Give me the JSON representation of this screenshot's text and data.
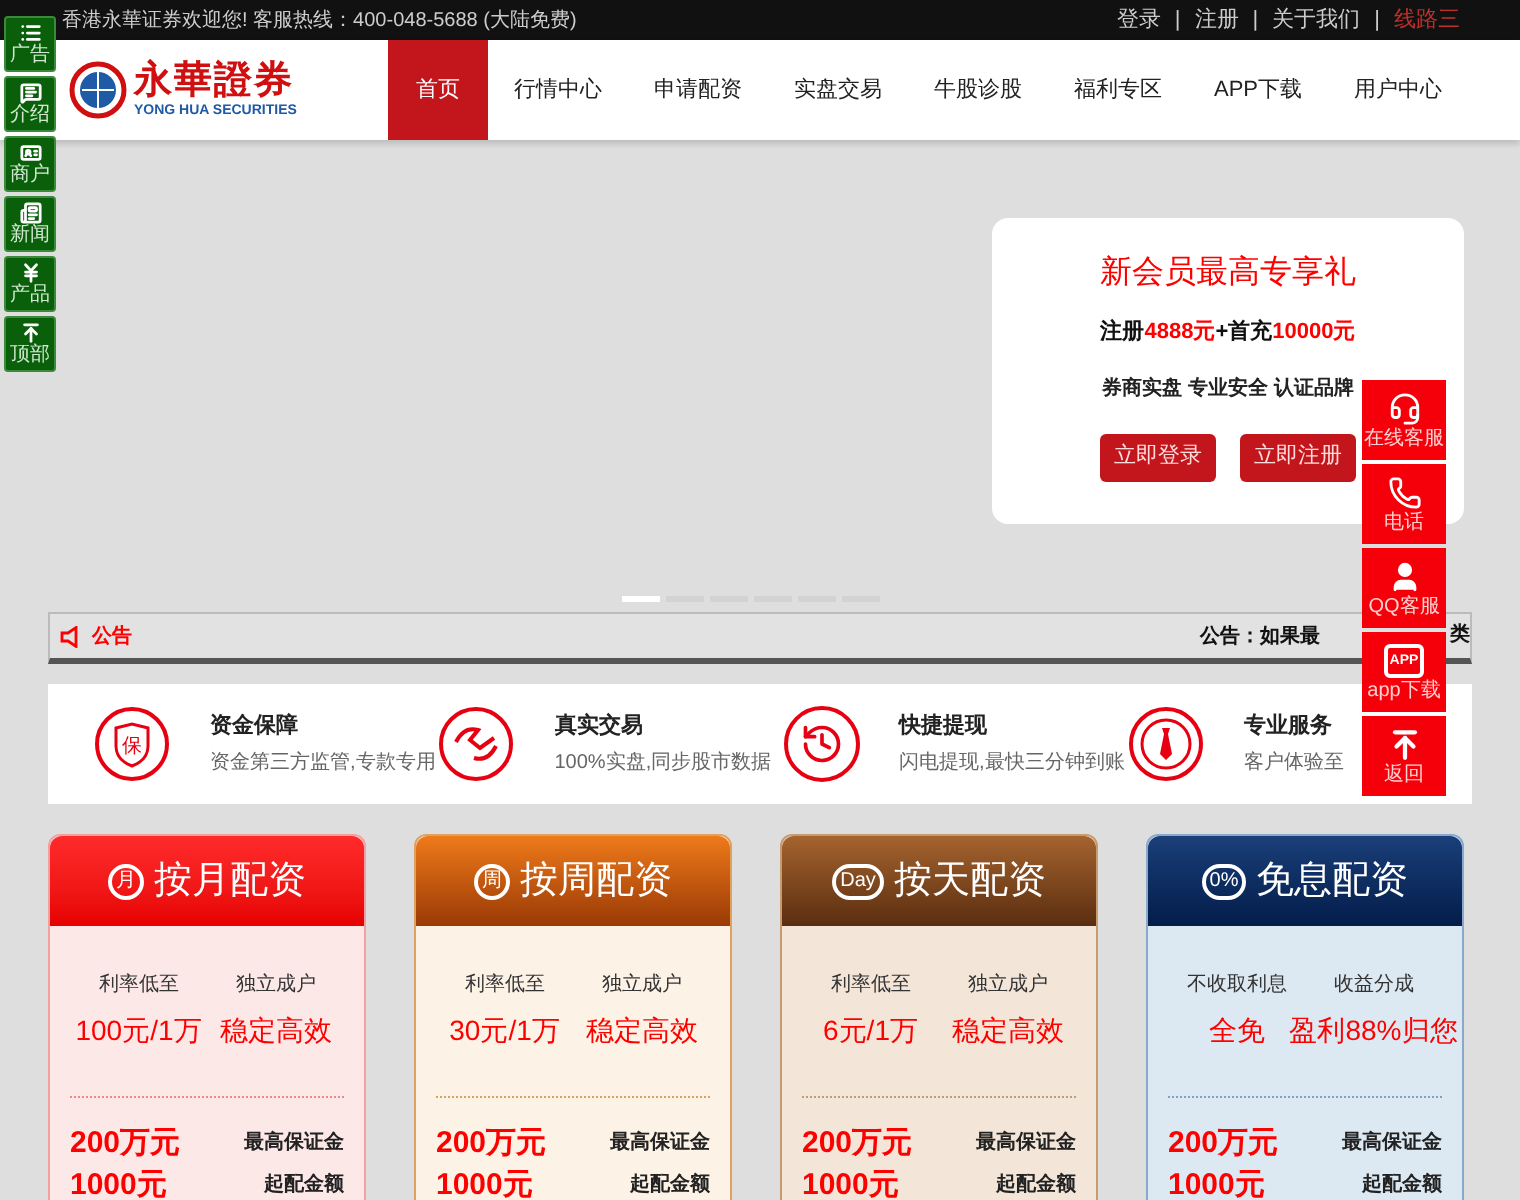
{
  "top_bar": {
    "welcome": "香港永華证券欢迎您! 客服热线：400-048-5688 (大陆免费)",
    "separator": "|",
    "links": [
      {
        "label": "登录",
        "highlighted": false
      },
      {
        "label": "注册",
        "highlighted": false
      },
      {
        "label": "关于我们",
        "highlighted": false
      },
      {
        "label": "线路三",
        "highlighted": true
      }
    ]
  },
  "logo": {
    "name": "永華證券",
    "subtitle": "YONG HUA SECURITIES"
  },
  "nav": [
    {
      "label": "首页",
      "selected": true
    },
    {
      "label": "行情中心",
      "selected": false
    },
    {
      "label": "申请配资",
      "selected": false
    },
    {
      "label": "实盘交易",
      "selected": false
    },
    {
      "label": "牛股诊股",
      "selected": false
    },
    {
      "label": "福利专区",
      "selected": false
    },
    {
      "label": "APP下载",
      "selected": false
    },
    {
      "label": "用户中心",
      "selected": false
    }
  ],
  "left_toolbar": [
    {
      "kind": "ad",
      "label": "广告"
    },
    {
      "kind": "intro",
      "label": "介绍"
    },
    {
      "kind": "merchant",
      "label": "商户"
    },
    {
      "kind": "news",
      "label": "新闻"
    },
    {
      "kind": "product",
      "label": "产品"
    },
    {
      "kind": "top",
      "label": "顶部"
    }
  ],
  "banner": {
    "title": "新会员最高专享礼",
    "offer": "注册**4888元**+首充**10000元**",
    "tagline": "券商实盘 专业安全 认证品牌",
    "buttons": [
      "立即登录",
      "立即注册"
    ]
  },
  "carousel": {
    "dots": [
      {
        "selected": true
      },
      {
        "selected": false
      },
      {
        "selected": false
      },
      {
        "selected": false
      },
      {
        "selected": false
      },
      {
        "selected": false
      }
    ]
  },
  "notice": {
    "label": "公告",
    "text": "公告：如果最",
    "tail": "类"
  },
  "features": [
    {
      "kind": "shield",
      "icon_text": "保",
      "title": "资金保障",
      "desc": "资金第三方监管,专款专用"
    },
    {
      "kind": "exchange",
      "title": "真实交易",
      "desc": "100%实盘,同步股市数据"
    },
    {
      "kind": "clock",
      "title": "快捷提现",
      "desc": "闪电提现,最快三分钟到账"
    },
    {
      "kind": "tie",
      "title": "专业服务",
      "desc": "客户体验至"
    }
  ],
  "right_float": [
    {
      "kind": "headset",
      "label": "在线客服"
    },
    {
      "kind": "phone",
      "label": "电话"
    },
    {
      "kind": "qq",
      "label": "QQ客服"
    },
    {
      "kind": "app",
      "icon_text": "APP",
      "label": "app下载"
    },
    {
      "kind": "top",
      "label": "返回"
    }
  ],
  "plans": [
    {
      "kind": "red",
      "icon_text": "月",
      "title": "按月配资",
      "stats": [
        {
          "label": "利率低至",
          "value": "100元/1万"
        },
        {
          "label": "独立成户",
          "value": "稳定高效"
        }
      ],
      "rows": [
        {
          "value": "200万元",
          "label": "最高保证金"
        },
        {
          "value": "1000元",
          "label": "起配金额"
        }
      ]
    },
    {
      "kind": "orange",
      "icon_text": "周",
      "title": "按周配资",
      "stats": [
        {
          "label": "利率低至",
          "value": "30元/1万"
        },
        {
          "label": "独立成户",
          "value": "稳定高效"
        }
      ],
      "rows": [
        {
          "value": "200万元",
          "label": "最高保证金"
        },
        {
          "value": "1000元",
          "label": "起配金额"
        }
      ]
    },
    {
      "kind": "brown",
      "icon_text": "Day",
      "title": "按天配资",
      "stats": [
        {
          "label": "利率低至",
          "value": "6元/1万"
        },
        {
          "label": "独立成户",
          "value": "稳定高效"
        }
      ],
      "rows": [
        {
          "value": "200万元",
          "label": "最高保证金"
        },
        {
          "value": "1000元",
          "label": "起配金额"
        }
      ]
    },
    {
      "kind": "navy",
      "icon_text": "0%",
      "title": "免息配资",
      "stats": [
        {
          "label": "不收取利息",
          "value": "全免"
        },
        {
          "label": "收益分成",
          "value": "盈利88%归您"
        }
      ],
      "rows": [
        {
          "value": "200万元",
          "label": "最高保证金"
        },
        {
          "value": "1000元",
          "label": "起配金额"
        }
      ]
    }
  ]
}
